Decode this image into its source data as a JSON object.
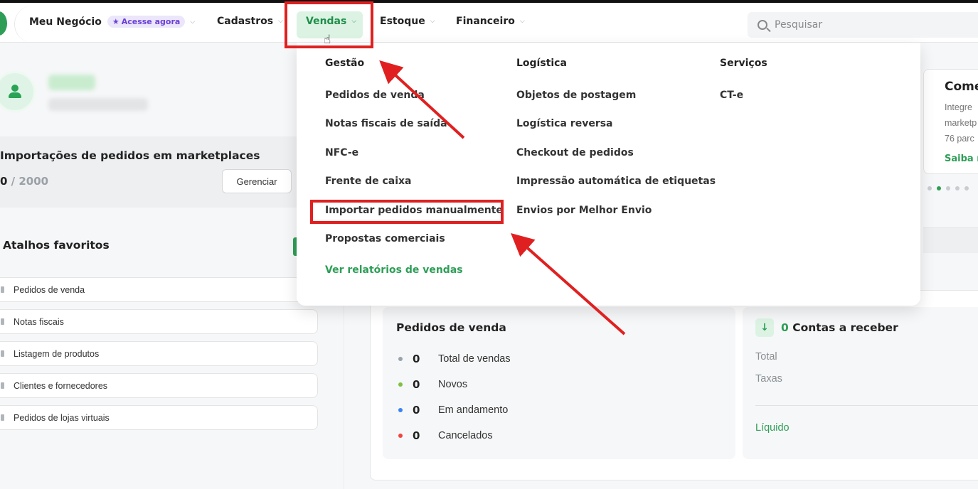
{
  "navbar": {
    "meu_negocio": "Meu Negócio",
    "badge": "Acesse agora",
    "cadastros": "Cadastros",
    "vendas": "Vendas",
    "estoque": "Estoque",
    "financeiro": "Financeiro",
    "search_placeholder": "Pesquisar"
  },
  "import": {
    "title": "Importações de pedidos em marketplaces",
    "current": "0",
    "separator": " / ",
    "total": "2000",
    "button": "Gerenciar"
  },
  "favorites": {
    "title": "Atalhos favoritos",
    "items": [
      "Pedidos de venda",
      "Notas fiscais",
      "Listagem de produtos",
      "Clientes e fornecedores",
      "Pedidos de lojas virtuais"
    ]
  },
  "dropdown": {
    "gestao": {
      "title": "Gestão",
      "items": [
        "Pedidos de venda",
        "Notas fiscais de saída",
        "NFC-e",
        "Frente de caixa",
        "Importar pedidos manualmente",
        "Propostas comerciais"
      ],
      "link": "Ver relatórios de vendas"
    },
    "logistica": {
      "title": "Logística",
      "items": [
        "Objetos de postagem",
        "Logística reversa",
        "Checkout de pedidos",
        "Impressão automática de etiquetas",
        "Envios por Melhor Envio"
      ]
    },
    "servicos": {
      "title": "Serviços",
      "items": [
        "CT-e"
      ]
    }
  },
  "side_card": {
    "title": "Come",
    "lines": [
      "Integre",
      "marketp",
      "76 parc"
    ],
    "link": "Saiba r"
  },
  "pedidos_card": {
    "title": "Pedidos de venda",
    "rows": [
      {
        "value": "0",
        "label": "Total de vendas",
        "color": "#9aa3ad"
      },
      {
        "value": "0",
        "label": "Novos",
        "color": "#7cc242"
      },
      {
        "value": "0",
        "label": "Em andamento",
        "color": "#3b82f6"
      },
      {
        "value": "0",
        "label": "Cancelados",
        "color": "#ef4444"
      }
    ]
  },
  "contas_card": {
    "arrow": "↓",
    "count": "0",
    "title": "Contas a receber",
    "total": "Total",
    "taxas": "Taxas",
    "liquido": "Líquido"
  },
  "colors": {
    "accent": "#2e9e57",
    "highlight": "#e02020",
    "badge": "#6a3fd6"
  }
}
